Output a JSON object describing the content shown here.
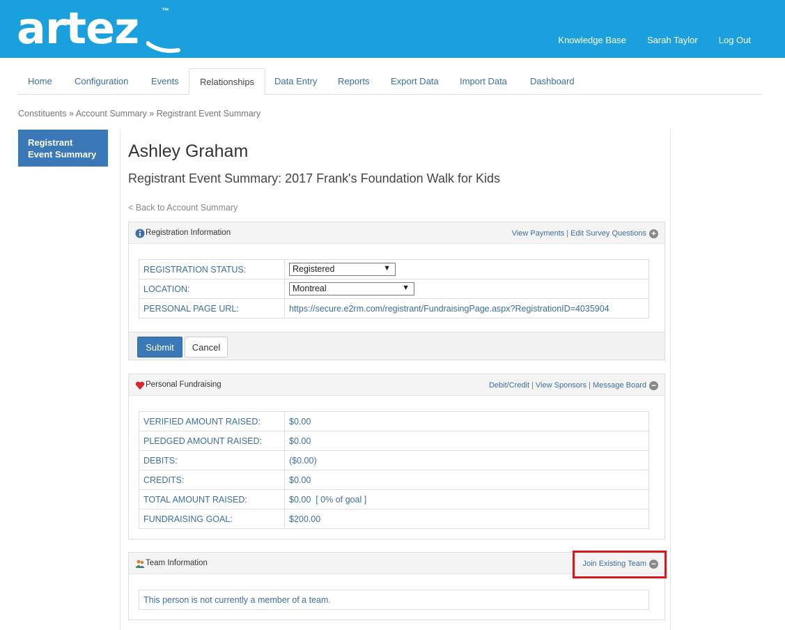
{
  "header": {
    "logo_text": "artez",
    "logo_tm": "™",
    "links": [
      "Knowledge Base",
      "Sarah Taylor",
      "Log Out"
    ],
    "color": "#1aa0dc"
  },
  "tabs": [
    {
      "label": "Home"
    },
    {
      "label": "Configuration"
    },
    {
      "label": "Events"
    },
    {
      "label": "Relationships",
      "active": true
    },
    {
      "label": "Data Entry"
    },
    {
      "label": "Reports"
    },
    {
      "label": "Export Data"
    },
    {
      "label": "Import Data"
    },
    {
      "label": "Dashboard"
    }
  ],
  "breadcrumb": "Constituents » Account Summary » Registrant Event Summary",
  "sidebar": {
    "item": "Registrant Event Summary"
  },
  "main": {
    "person_name": "Ashley Graham",
    "subtitle": "Registrant Event Summary: 2017 Frank's Foundation Walk for Kids",
    "back_link": "< Back to Account Summary"
  },
  "registration": {
    "title": "Registration Information",
    "link_payments": "View Payments",
    "link_survey": "Edit Survey Questions",
    "status_label": "REGISTRATION STATUS:",
    "status_value": "Registered",
    "location_label": "LOCATION:",
    "location_value": "Montreal",
    "url_label": "PERSONAL PAGE URL:",
    "url_value": "https://secure.e2rm.com/registrant/FundraisingPage.aspx?RegistrationID=4035904",
    "submit": "Submit",
    "cancel": "Cancel"
  },
  "fundraising": {
    "title": "Personal Fundraising",
    "link_debit": "Debit/Credit",
    "link_sponsors": "View Sponsors",
    "link_board": "Message Board",
    "rows": [
      {
        "label": "VERIFIED AMOUNT RAISED:",
        "value": "$0.00"
      },
      {
        "label": "PLEDGED AMOUNT RAISED:",
        "value": "$0.00"
      },
      {
        "label": "DEBITS:",
        "value": "($0.00)"
      },
      {
        "label": "CREDITS:",
        "value": "$0.00"
      },
      {
        "label": "TOTAL AMOUNT RAISED:",
        "value": "$0.00  [ 0% of goal ]"
      },
      {
        "label": "FUNDRAISING GOAL:",
        "value": "$200.00"
      }
    ]
  },
  "team": {
    "title": "Team Information",
    "link_join": "Join Existing Team",
    "message": "This person is not currently a member of a team."
  }
}
